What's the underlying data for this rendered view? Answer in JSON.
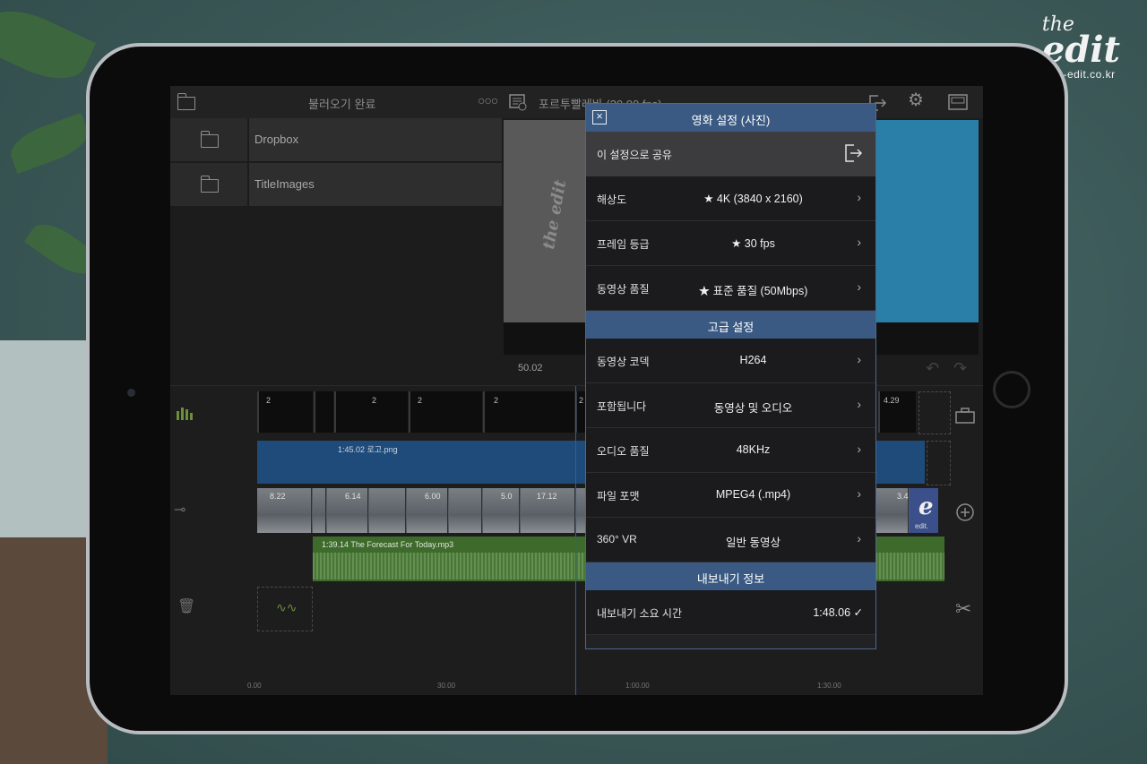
{
  "watermark": {
    "brand_top": "the",
    "brand_main": "edit",
    "url": "the-edit.co.kr"
  },
  "app": {
    "topbar": {
      "import_status": "불러오기 완료",
      "project_title": "포르투빨레바 (30.00 fps)"
    },
    "library": {
      "items": [
        {
          "label": "Dropbox"
        },
        {
          "label": "TitleImages"
        }
      ]
    },
    "preview": {
      "overlay_text": "the edit",
      "timecode": "50.02"
    },
    "timeline": {
      "clip_labels": [
        "2",
        "2",
        "2",
        "2",
        "2",
        "4.29"
      ],
      "title_track_label": "1:45.02  로고.png",
      "video_track_labels": [
        "8.22",
        "6.14",
        "6.00",
        "5.0",
        "17.12",
        "3.4"
      ],
      "audio_track_label": "1:39.14  The Forecast For Today.mp3",
      "ruler": [
        "0.00",
        "30.00",
        "1:00.00",
        "1:30.00"
      ],
      "end_clip_label": "edit."
    }
  },
  "modal": {
    "title": "영화 설정 (사진)",
    "share": {
      "label": "이 설정으로 공유"
    },
    "settings": [
      {
        "label": "해상도",
        "value": "★ 4K (3840 x 2160)"
      },
      {
        "label": "프레임 등급",
        "value": "★ 30 fps"
      },
      {
        "label": "동영상 품질",
        "value": "★ 표준 품질 (50Mbps)"
      }
    ],
    "advanced_header": "고급 설정",
    "advanced": [
      {
        "label": "동영상 코덱",
        "value": "H264"
      },
      {
        "label": "포함됩니다",
        "value": "동영상 및 오디오"
      },
      {
        "label": "오디오 품질",
        "value": "48KHz"
      },
      {
        "label": "파일 포맷",
        "value": "MPEG4 (.mp4)"
      },
      {
        "label": "360° VR",
        "value": "일반 동영상"
      }
    ],
    "export_header": "내보내기 정보",
    "export_time": {
      "label": "내보내기 소요 시간",
      "value": "1:48.06 ✓"
    }
  },
  "icons": {
    "close": "close-icon",
    "share": "export-icon",
    "chevron": "chevron-right-icon",
    "folder": "folder-icon",
    "more": "more-icon",
    "settings": "gear-icon",
    "layout": "layout-icon",
    "scissors": "scissors-icon",
    "add": "add-icon",
    "trash": "trash-icon"
  },
  "colors": {
    "modal_header": "#3a5a83",
    "title_track": "#1e4b7a",
    "audio_track": "#3e6a2c"
  }
}
